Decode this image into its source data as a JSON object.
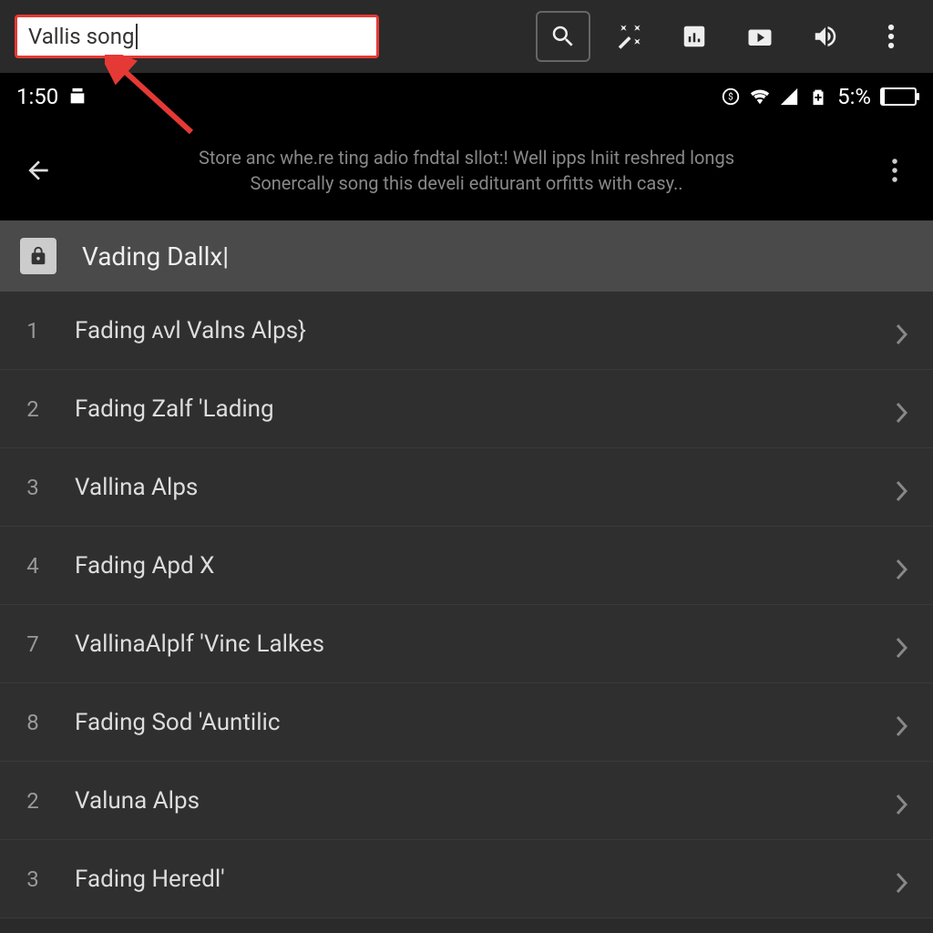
{
  "toolbar": {
    "search_value": "Vallis song",
    "icons": [
      "search",
      "wand",
      "chart",
      "video",
      "sound",
      "more"
    ]
  },
  "status": {
    "time": "1:50",
    "battery_text": "5:%"
  },
  "header": {
    "description_line1": "Store anc whe.re ting adio fndtal sllot:! Well ipps lniit reshred longs",
    "description_line2": "Sonercally song this develi editurant orfitts with casy.."
  },
  "section": {
    "title": "Vading Dallx|"
  },
  "songs": [
    {
      "num": "1",
      "title": "Fading ͏ᴀᴠl Valns Alps}"
    },
    {
      "num": "2",
      "title": "Fading Zalf 'Lading"
    },
    {
      "num": "3",
      "title": "Vallina Alps"
    },
    {
      "num": "4",
      "title": "Fading Apd X"
    },
    {
      "num": "7",
      "title": "VallinaAlplf 'Vinє Lalkes"
    },
    {
      "num": "8",
      "title": "Fading Sod 'Auntilic"
    },
    {
      "num": "2",
      "title": "Valuna Alps"
    },
    {
      "num": "3",
      "title": "Fading Heredl'"
    }
  ]
}
